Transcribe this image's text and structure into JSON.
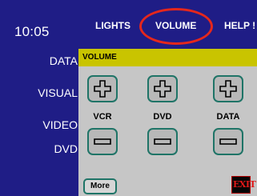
{
  "clock": "10:05",
  "topnav": {
    "lights": "LIGHTS",
    "volume": "VOLUME",
    "help": "HELP !"
  },
  "sidebar": {
    "items": [
      "DATA",
      "VISUAL",
      "VIDEO",
      "DVD"
    ]
  },
  "panel": {
    "title": "VOLUME",
    "devices": [
      "VCR",
      "DVD",
      "DATA"
    ]
  },
  "buttons": {
    "more": "More",
    "exit": "EXIT"
  },
  "colors": {
    "background": "#1f1d86",
    "panel": "#c6c6c6",
    "header": "#c9c400",
    "button_border": "#1f7467",
    "highlight_ring": "#e5271c",
    "exit_text": "#e01818"
  },
  "icons": {
    "volume_up": "plus-icon",
    "volume_down": "minus-icon"
  }
}
